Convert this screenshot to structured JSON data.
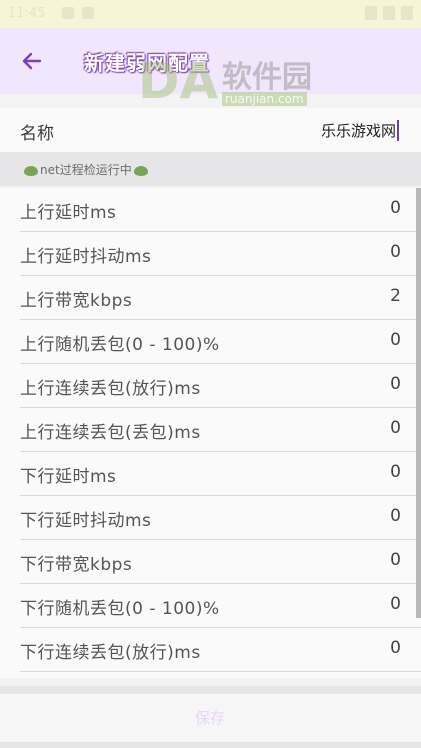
{
  "status_bar": {
    "time": "11:45"
  },
  "app_bar": {
    "title": "新建弱网配置"
  },
  "watermark": {
    "brand": "软件园",
    "url": "ruanjian.com"
  },
  "name_field": {
    "label": "名称",
    "value": "乐乐游戏网"
  },
  "section": {
    "title": "net过程检运行中"
  },
  "rows": [
    {
      "label": "上行延时ms",
      "value": "0"
    },
    {
      "label": "上行延时抖动ms",
      "value": "0"
    },
    {
      "label": "上行带宽kbps",
      "value": "2"
    },
    {
      "label": "上行随机丢包(0 - 100)%",
      "value": "0"
    },
    {
      "label": "上行连续丢包(放行)ms",
      "value": "0"
    },
    {
      "label": "上行连续丢包(丢包)ms",
      "value": "0"
    },
    {
      "label": "下行延时ms",
      "value": "0"
    },
    {
      "label": "下行延时抖动ms",
      "value": "0"
    },
    {
      "label": "下行带宽kbps",
      "value": "0"
    },
    {
      "label": "下行随机丢包(0 - 100)%",
      "value": "0"
    },
    {
      "label": "下行连续丢包(放行)ms",
      "value": "0"
    }
  ],
  "save": {
    "label": "保存"
  },
  "colors": {
    "accent": "#7b3fb6",
    "app_bar_bg": "#f1e6fb",
    "status_bar_bg": "#f7f5d6"
  }
}
